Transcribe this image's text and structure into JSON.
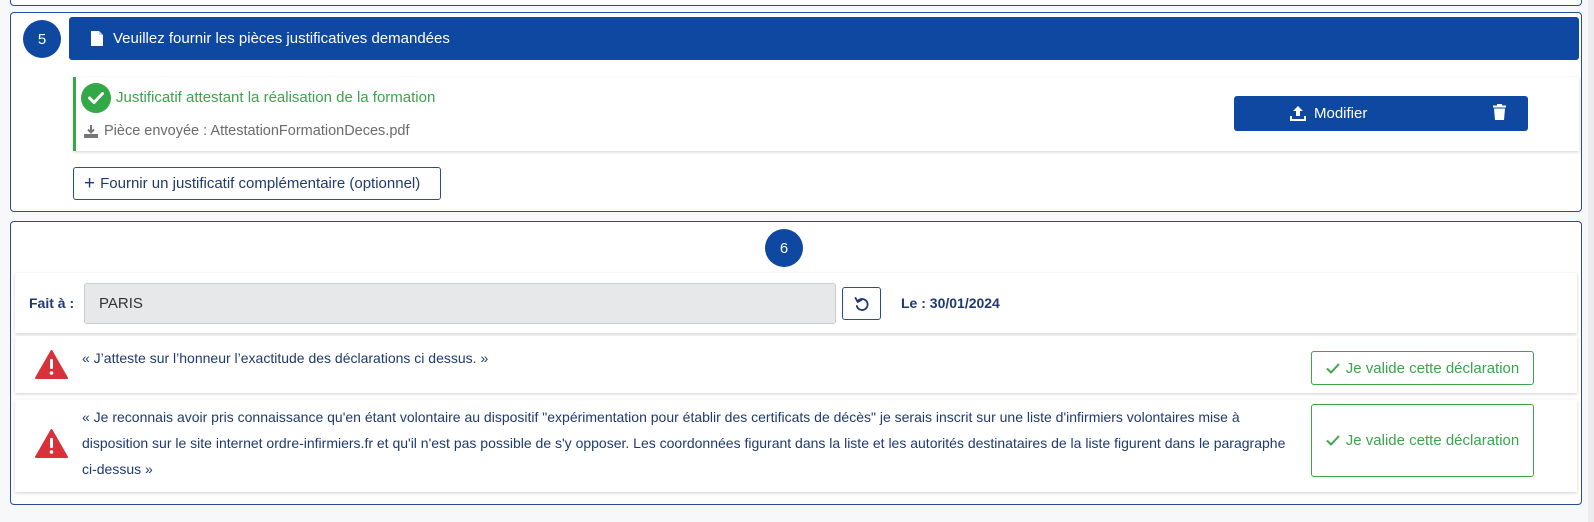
{
  "section5": {
    "step": "5",
    "header": "Veuillez fournir les pièces justificatives demandées",
    "justificatif": {
      "title": "Justificatif attestant la réalisation de la formation",
      "file_label": "Pièce envoyée : AttestationFormationDeces.pdf",
      "modify_label": "Modifier"
    },
    "add_label": "Fournir un justificatif complémentaire (optionnel)"
  },
  "section6": {
    "step": "6",
    "fait_label": "Fait à :",
    "city_value": "PARIS",
    "date_label": "Le : 30/01/2024",
    "declarations": [
      {
        "text": "« J’atteste sur l’honneur l’exactitude des déclarations ci dessus. »",
        "button": "Je valide cette déclaration"
      },
      {
        "text": "« Je reconnais avoir pris connaissance qu'en étant volontaire au dispositif \"expérimentation pour établir des certificats de décès\" je serais inscrit sur une liste d'infirmiers volontaires mise à disposition sur le site internet ordre-infirmiers.fr et qu'il n'est pas possible de s'y opposer. Les coordonnées figurant dans la liste et les autorités destinataires de la liste figurent dans le paragraphe ci-dessus »",
        "button": "Je valide cette déclaration"
      }
    ]
  },
  "colors": {
    "primary": "#0e48a1",
    "success": "#3ca44b",
    "warning": "#d9313a",
    "text": "#1f3a70"
  },
  "icons": [
    "document-icon",
    "check-circle-icon",
    "download-icon",
    "upload-icon",
    "trash-icon",
    "plus-icon",
    "undo-icon",
    "warning-icon",
    "check-icon"
  ]
}
